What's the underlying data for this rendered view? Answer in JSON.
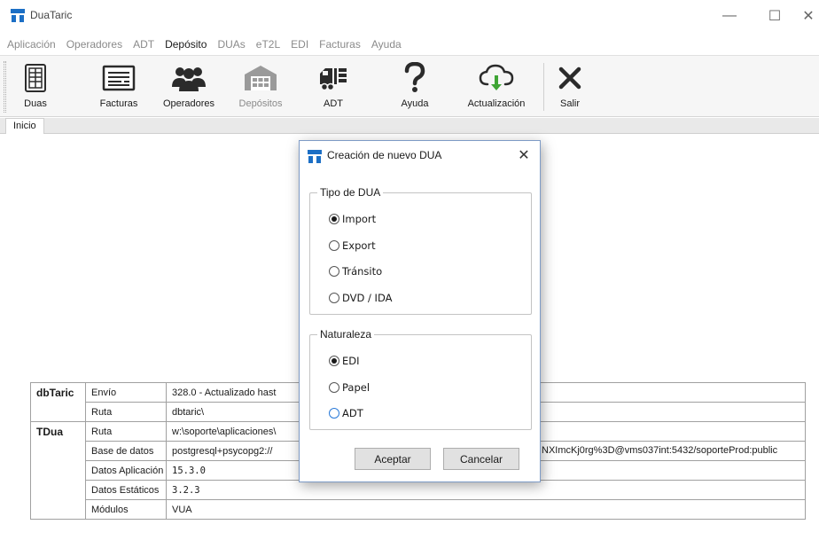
{
  "window": {
    "title": "DuaTaric",
    "minimize_glyph": "—",
    "maximize_glyph": "☐",
    "close_glyph": "✕"
  },
  "menu": [
    {
      "label": "Aplicación",
      "active": false
    },
    {
      "label": "Operadores",
      "active": false
    },
    {
      "label": "ADT",
      "active": false
    },
    {
      "label": "Depósito",
      "active": true
    },
    {
      "label": "DUAs",
      "active": false
    },
    {
      "label": "eT2L",
      "active": false
    },
    {
      "label": "EDI",
      "active": false
    },
    {
      "label": "Facturas",
      "active": false
    },
    {
      "label": "Ayuda",
      "active": false
    }
  ],
  "toolbar": {
    "duas": {
      "label": "Duas",
      "icon": "document-icon"
    },
    "facturas": {
      "label": "Facturas",
      "icon": "invoice-icon"
    },
    "operadores": {
      "label": "Operadores",
      "icon": "users-icon"
    },
    "depositos": {
      "label": "Depósitos",
      "icon": "warehouse-icon",
      "disabled": true
    },
    "adt": {
      "label": "ADT",
      "icon": "truck-icon"
    },
    "ayuda": {
      "label": "Ayuda",
      "icon": "question-icon"
    },
    "actualizacion": {
      "label": "Actualización",
      "icon": "cloud-download-icon"
    },
    "salir": {
      "label": "Salir",
      "icon": "close-x-icon"
    }
  },
  "tabs": {
    "inicio": "Inicio"
  },
  "info_table": {
    "groups": [
      {
        "name": "dbTaric",
        "rows": [
          {
            "key": "Envío",
            "value": "328.0 - Actualizado hast"
          },
          {
            "key": "Ruta",
            "value": "dbtaric\\"
          }
        ]
      },
      {
        "name": "TDua",
        "rows": [
          {
            "key": "Ruta",
            "value": "w:\\soporte\\aplicaciones\\"
          },
          {
            "key": "Base de datos",
            "value": "postgresql+psycopg2://",
            "value_right": "NXImcKj0rg%3D@vms037int:5432/soporteProd:public"
          },
          {
            "key": "Datos Aplicación",
            "value": "15.3.0"
          },
          {
            "key": "Datos Estáticos",
            "value": "3.2.3"
          },
          {
            "key": "Módulos",
            "value": "VUA"
          }
        ]
      }
    ]
  },
  "dialog": {
    "title": "Creación de nuevo DUA",
    "close_glyph": "✕",
    "tipo": {
      "legend": "Tipo de DUA",
      "options": [
        "Import",
        "Export",
        "Tránsito",
        "DVD / IDA"
      ],
      "selected": "Import"
    },
    "naturaleza": {
      "legend": "Naturaleza",
      "options": [
        "EDI",
        "Papel",
        "ADT"
      ],
      "selected": "EDI"
    },
    "accept_label": "Aceptar",
    "cancel_label": "Cancelar"
  },
  "colors": {
    "logo_blue": "#1c6fc5",
    "dialog_border": "#7e9bc6",
    "icon_dark": "#2b2b2b",
    "icon_disabled": "#9a9a9a",
    "cloud_arrow": "#3fa535"
  }
}
